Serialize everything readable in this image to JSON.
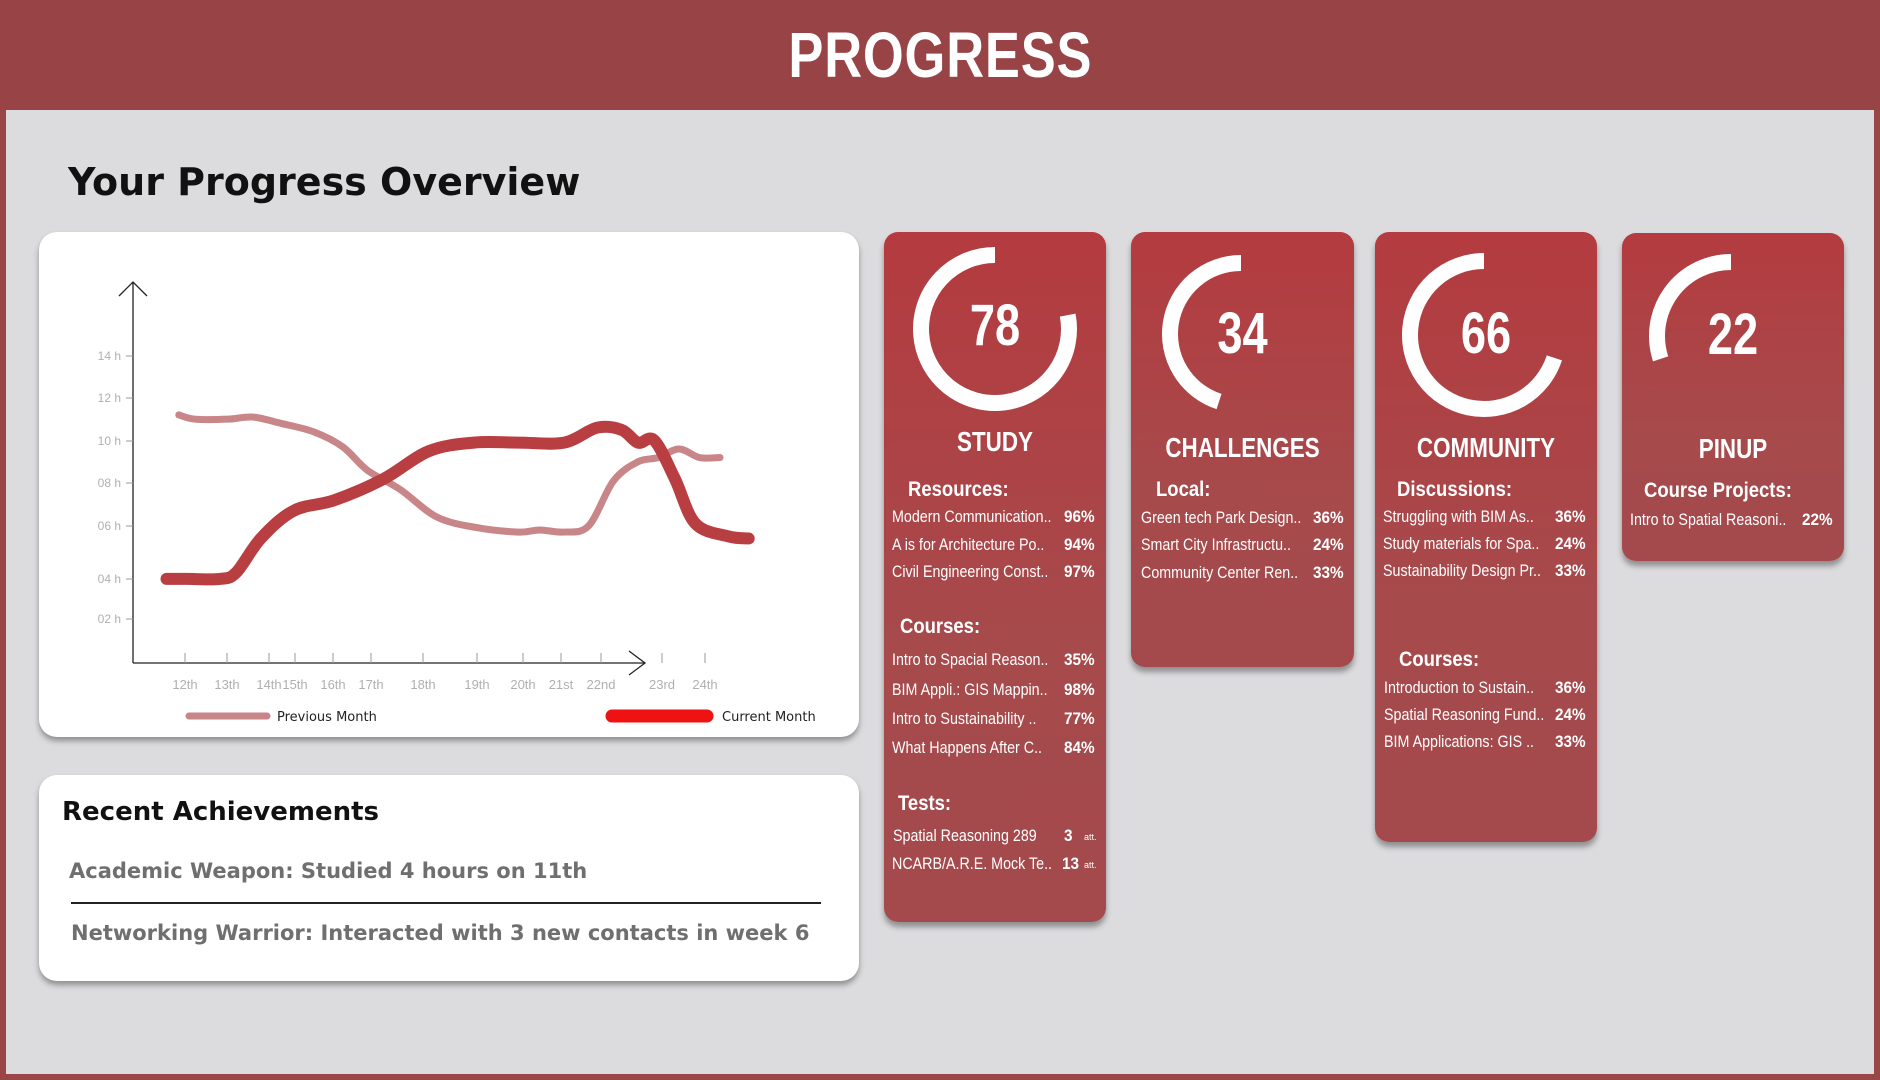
{
  "header": {
    "title": "PROGRESS"
  },
  "overview": {
    "title": "Your Progress Overview"
  },
  "chart_data": {
    "type": "line",
    "x_tick_labels": [
      "12th",
      "13th",
      "14th",
      "15th",
      "16th",
      "17th",
      "18th",
      "19th",
      "20th",
      "21st",
      "22nd",
      "23rd",
      "24th"
    ],
    "y_tick_labels": [
      "02 h",
      "04 h",
      "06 h",
      "08 h",
      "10 h",
      "12 h",
      "14 h"
    ],
    "ylim": [
      0,
      15
    ],
    "series": [
      {
        "name": "Previous Month",
        "color": "#c98688",
        "points": [
          [
            0.8,
            11.6
          ],
          [
            1.2,
            11.4
          ],
          [
            2.0,
            11.4
          ],
          [
            2.6,
            11.5
          ],
          [
            3.3,
            11.2
          ],
          [
            4.1,
            10.8
          ],
          [
            4.8,
            10.1
          ],
          [
            5.4,
            9.0
          ],
          [
            6.2,
            8.1
          ],
          [
            7.1,
            6.8
          ],
          [
            8.1,
            6.3
          ],
          [
            9.1,
            6.1
          ],
          [
            9.6,
            6.2
          ],
          [
            10.2,
            6.1
          ],
          [
            10.8,
            6.4
          ],
          [
            11.4,
            8.5
          ],
          [
            12.0,
            9.4
          ],
          [
            12.5,
            9.6
          ],
          [
            13.0,
            10.0
          ],
          [
            13.5,
            9.6
          ],
          [
            14.0,
            9.6
          ]
        ]
      },
      {
        "name": "Current Month",
        "color": "#b83e42",
        "points": [
          [
            0.5,
            3.9
          ],
          [
            1.0,
            3.9
          ],
          [
            1.8,
            3.9
          ],
          [
            2.2,
            4.2
          ],
          [
            2.8,
            5.8
          ],
          [
            3.6,
            7.1
          ],
          [
            4.6,
            7.6
          ],
          [
            5.8,
            8.6
          ],
          [
            6.9,
            9.9
          ],
          [
            8.0,
            10.3
          ],
          [
            9.1,
            10.3
          ],
          [
            10.2,
            10.3
          ],
          [
            11.0,
            11.0
          ],
          [
            11.6,
            10.9
          ],
          [
            12.0,
            10.3
          ],
          [
            12.4,
            10.4
          ],
          [
            12.9,
            8.6
          ],
          [
            13.4,
            6.5
          ],
          [
            14.2,
            5.9
          ],
          [
            14.7,
            5.8
          ]
        ]
      }
    ],
    "legend": [
      "Previous Month",
      "Current Month"
    ],
    "legend_position": "bottom"
  },
  "achievements": {
    "title": "Recent Achievements",
    "items": [
      "Academic Weapon: Studied 4 hours on 11th",
      "Networking Warrior: Interacted with 3 new contacts in week 6"
    ]
  },
  "cards": [
    {
      "value": 78,
      "value_label": "78",
      "ring_fraction": 0.78,
      "label": "STUDY",
      "sections": [
        {
          "title": "Resources:",
          "items": [
            {
              "name": "Modern Communication..",
              "value": "96%"
            },
            {
              "name": "A is for Architecture Po..",
              "value": "94%"
            },
            {
              "name": "Civil Engineering Const..",
              "value": "97%"
            }
          ]
        },
        {
          "title": "Courses:",
          "items": [
            {
              "name": "Intro to Spacial Reason..",
              "value": "35%"
            },
            {
              "name": "BIM Appli.: GIS Mappin..",
              "value": "98%"
            },
            {
              "name": "Intro to Sustainability ..",
              "value": "77%"
            },
            {
              "name": "What Happens After C..",
              "value": "84%"
            }
          ]
        },
        {
          "title": "Tests:",
          "items": [
            {
              "name": "Spatial Reasoning 289",
              "value": "3",
              "suffix": "att."
            },
            {
              "name": "NCARB/A.R.E. Mock Te..",
              "value": "13",
              "suffix": "att."
            }
          ]
        }
      ]
    },
    {
      "value": 34,
      "value_label": "34",
      "ring_fraction": 0.45,
      "label": "CHALLENGES",
      "sections": [
        {
          "title": "Local:",
          "items": [
            {
              "name": "Green tech Park Design..",
              "value": "36%"
            },
            {
              "name": "Smart City Infrastructu..",
              "value": "24%"
            },
            {
              "name": "Community Center Ren..",
              "value": "33%"
            }
          ]
        }
      ]
    },
    {
      "value": 66,
      "value_label": "66",
      "ring_fraction": 0.7,
      "label": "COMMUNITY",
      "sections": [
        {
          "title": "Discussions:",
          "items": [
            {
              "name": "Struggling with BIM As..",
              "value": "36%"
            },
            {
              "name": "Study materials for Spa..",
              "value": "24%"
            },
            {
              "name": "Sustainability Design Pr..",
              "value": "33%"
            }
          ]
        },
        {
          "title": "Courses:",
          "items": [
            {
              "name": "Introduction to Sustain..",
              "value": "36%"
            },
            {
              "name": "Spatial Reasoning Fund..",
              "value": "24%"
            },
            {
              "name": "BIM Applications: GIS ..",
              "value": "33%"
            }
          ]
        }
      ]
    },
    {
      "value": 22,
      "value_label": "22",
      "ring_fraction": 0.3,
      "label": "PINUP",
      "sections": [
        {
          "title": "Course Projects:",
          "items": [
            {
              "name": "Intro to Spatial Reasoni..",
              "value": "22%"
            }
          ]
        }
      ]
    }
  ]
}
